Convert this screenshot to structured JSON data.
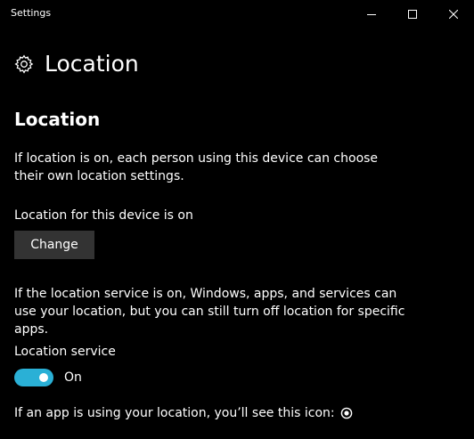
{
  "window": {
    "title": "Settings",
    "controls": [
      "minimize-icon",
      "maximize-icon",
      "close-icon"
    ]
  },
  "header": {
    "icon": "gear-icon",
    "title": "Location"
  },
  "section": {
    "title": "Location",
    "intro": "If location is on, each person using this device can choose their own location settings.",
    "device_status": "Location for this device is on",
    "change_label": "Change",
    "service_description": "If the location service is on, Windows, apps, and services can use your location, but you can still turn off location for specific apps.",
    "service_label": "Location service",
    "service_toggle": {
      "state": "On",
      "on": true
    },
    "in_use_text": "If an app is using your location, you’ll see this icon:",
    "in_use_icon": "location-in-use-icon"
  },
  "colors": {
    "background": "#000000",
    "text": "#ffffff",
    "accent": "#2ab0d6",
    "button": "#333333"
  }
}
